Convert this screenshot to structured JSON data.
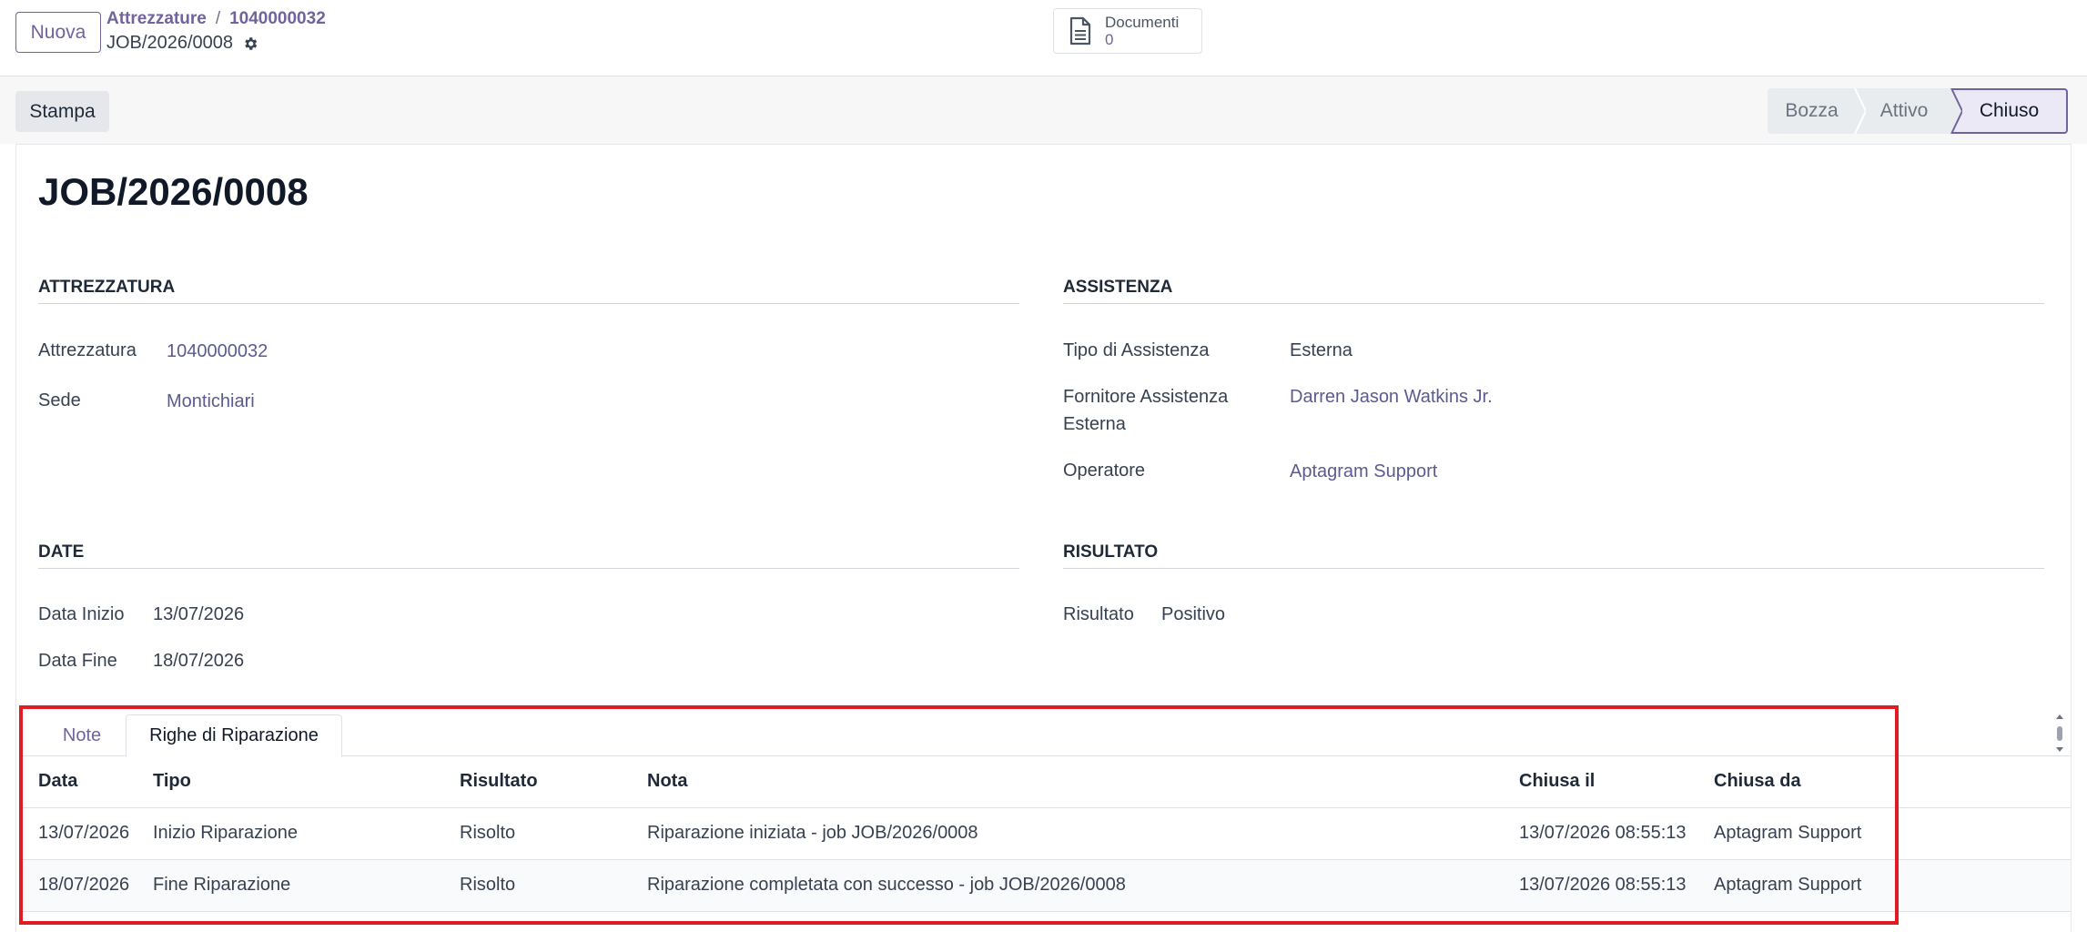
{
  "topbar": {
    "new_label": "Nuova",
    "breadcrumb": [
      "Attrezzature",
      "1040000032"
    ],
    "breadcrumb_separator": "/",
    "record": "JOB/2026/0008",
    "smart_button": {
      "label": "Documenti",
      "count": "0"
    }
  },
  "actions": {
    "print_label": "Stampa"
  },
  "status": {
    "stages": [
      "Bozza",
      "Attivo",
      "Chiuso"
    ],
    "current": "Chiuso"
  },
  "form": {
    "title": "JOB/2026/0008",
    "attrezzatura": {
      "heading": "ATTREZZATURA",
      "fields": [
        {
          "label": "Attrezzatura",
          "value": "1040000032"
        },
        {
          "label": "Sede",
          "value": "Montichiari"
        }
      ]
    },
    "assistenza": {
      "heading": "ASSISTENZA",
      "fields": [
        {
          "label": "Tipo di Assistenza",
          "value": "Esterna"
        },
        {
          "label": "Fornitore Assistenza Esterna",
          "value": "Darren Jason Watkins Jr."
        },
        {
          "label": "Operatore",
          "value": "Aptagram Support"
        }
      ]
    },
    "date": {
      "heading": "DATE",
      "fields": [
        {
          "label": "Data Inizio",
          "value": "13/07/2026"
        },
        {
          "label": "Data Fine",
          "value": "18/07/2026"
        }
      ]
    },
    "risultato": {
      "heading": "RISULTATO",
      "fields": [
        {
          "label": "Risultato",
          "value": "Positivo"
        }
      ]
    }
  },
  "notebook": {
    "tabs": [
      "Note",
      "Righe di Riparazione"
    ],
    "active_tab": "Righe di Riparazione",
    "columns": [
      "Data",
      "Tipo",
      "Risultato",
      "Nota",
      "Chiusa il",
      "Chiusa da"
    ],
    "rows": [
      [
        "13/07/2026",
        "Inizio Riparazione",
        "Risolto",
        "Riparazione iniziata - job JOB/2026/0008",
        "13/07/2026 08:55:13",
        "Aptagram Support"
      ],
      [
        "18/07/2026",
        "Fine Riparazione",
        "Risolto",
        "Riparazione completata con successo - job JOB/2026/0008",
        "13/07/2026 08:55:13",
        "Aptagram Support"
      ]
    ]
  },
  "colors": {
    "accent": "#71639e",
    "link": "#5b5a91",
    "highlight": "#e01b24"
  },
  "icons": {
    "gear": "gear-icon",
    "document": "document-icon"
  }
}
